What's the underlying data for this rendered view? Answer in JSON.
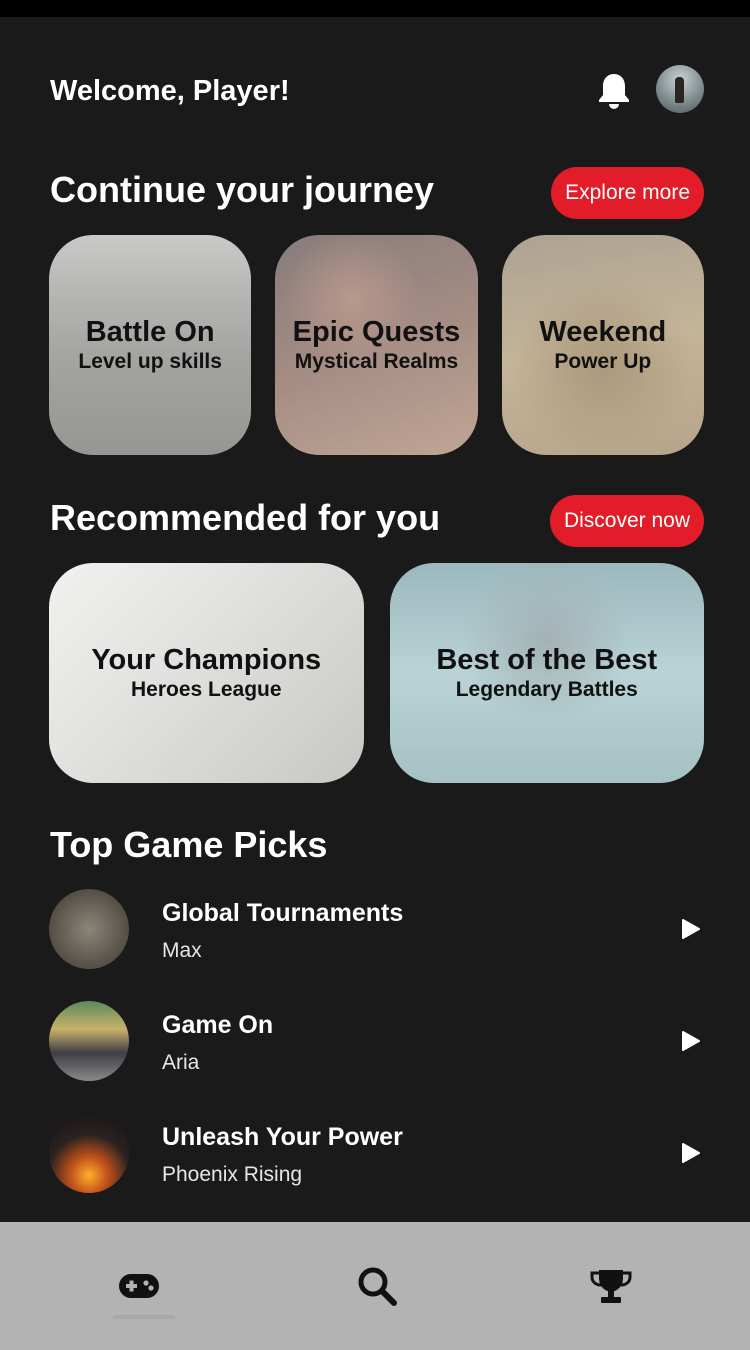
{
  "header": {
    "welcome": "Welcome, Player!",
    "icons": [
      "bell-icon",
      "avatar"
    ]
  },
  "continue": {
    "title": "Continue your journey",
    "button": "Explore more",
    "cards": [
      {
        "title": "Battle On",
        "subtitle": "Level up skills"
      },
      {
        "title": "Epic Quests",
        "subtitle": "Mystical Realms"
      },
      {
        "title": "Weekend",
        "subtitle": "Power Up"
      }
    ]
  },
  "recommended": {
    "title": "Recommended for you",
    "button": "Discover now",
    "cards": [
      {
        "title": "Your Champions",
        "subtitle": "Heroes League"
      },
      {
        "title": "Best of the Best",
        "subtitle": "Legendary Battles"
      }
    ]
  },
  "top_picks": {
    "title": "Top Game Picks",
    "items": [
      {
        "title": "Global Tournaments",
        "subtitle": "Max"
      },
      {
        "title": "Game On",
        "subtitle": "Aria"
      },
      {
        "title": "Unleash Your Power",
        "subtitle": "Phoenix Rising"
      }
    ]
  },
  "nav": {
    "items": [
      "gamepad-icon",
      "search-icon",
      "trophy-icon"
    ],
    "active": "gamepad-icon"
  },
  "colors": {
    "background": "#1a1a1a",
    "accent": "#e31c2a",
    "navbar": "#b3b3b3"
  }
}
